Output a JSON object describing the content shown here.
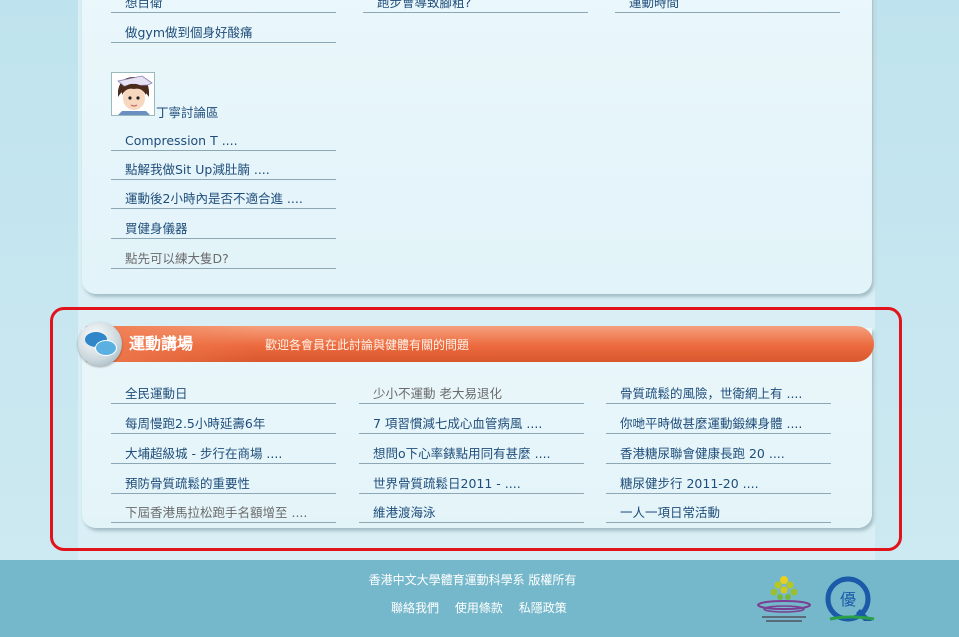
{
  "upper": {
    "row0": [
      "想目衛",
      "跑步會導致腳粗?",
      "運動時間"
    ],
    "row1": [
      "做gym做到個身好酸痛"
    ],
    "forum_name": "丁寧討論區",
    "forum_items": [
      "Compression T ....",
      "點解我做Sit Up減肚腩 ....",
      "運動後2小時內是否不適合進 ....",
      "買健身儀器",
      "點先可以練大隻D?"
    ]
  },
  "section": {
    "title": "運動講場",
    "description": "歡迎各會員在此討論與健體有關的問題",
    "columns": [
      [
        "全民運動日",
        "每周慢跑2.5小時延壽6年",
        "大埔超級城 - 步行在商場 ....",
        "預防骨質疏鬆的重要性",
        "下屆香港馬拉松跑手名額增至 ...."
      ],
      [
        "少小不運動 老大易退化",
        "7 項習慣減七成心血管病風 ....",
        "想問o下心率錶點用同有甚麼 ....",
        "世界骨質疏鬆日2011 - ....",
        "維港渡海泳"
      ],
      [
        "骨質疏鬆的風險，世衛網上有 ....",
        "你哋平時做甚麼運動鍛練身體 ....",
        "香港糖尿聯會健康長跑 20 ....",
        "糖尿健步行 2011-20 ....",
        "一人一項日常活動"
      ]
    ]
  },
  "footer": {
    "copyright": "香港中文大學體育運動科學系 版權所有",
    "links": [
      "聯絡我們",
      "使用條款",
      "私隱政策"
    ],
    "logo2_char": "優"
  },
  "colors": {
    "link": "#1f4d7a",
    "visited": "#6b6b6b",
    "banner": "#ec6a3e",
    "footer": "#76b8cb",
    "highlight": "#e2141b"
  },
  "icons": [
    "avatar-icon",
    "speech-bubble-icon",
    "knowledge-transfer-logo",
    "quality-mark-logo"
  ]
}
